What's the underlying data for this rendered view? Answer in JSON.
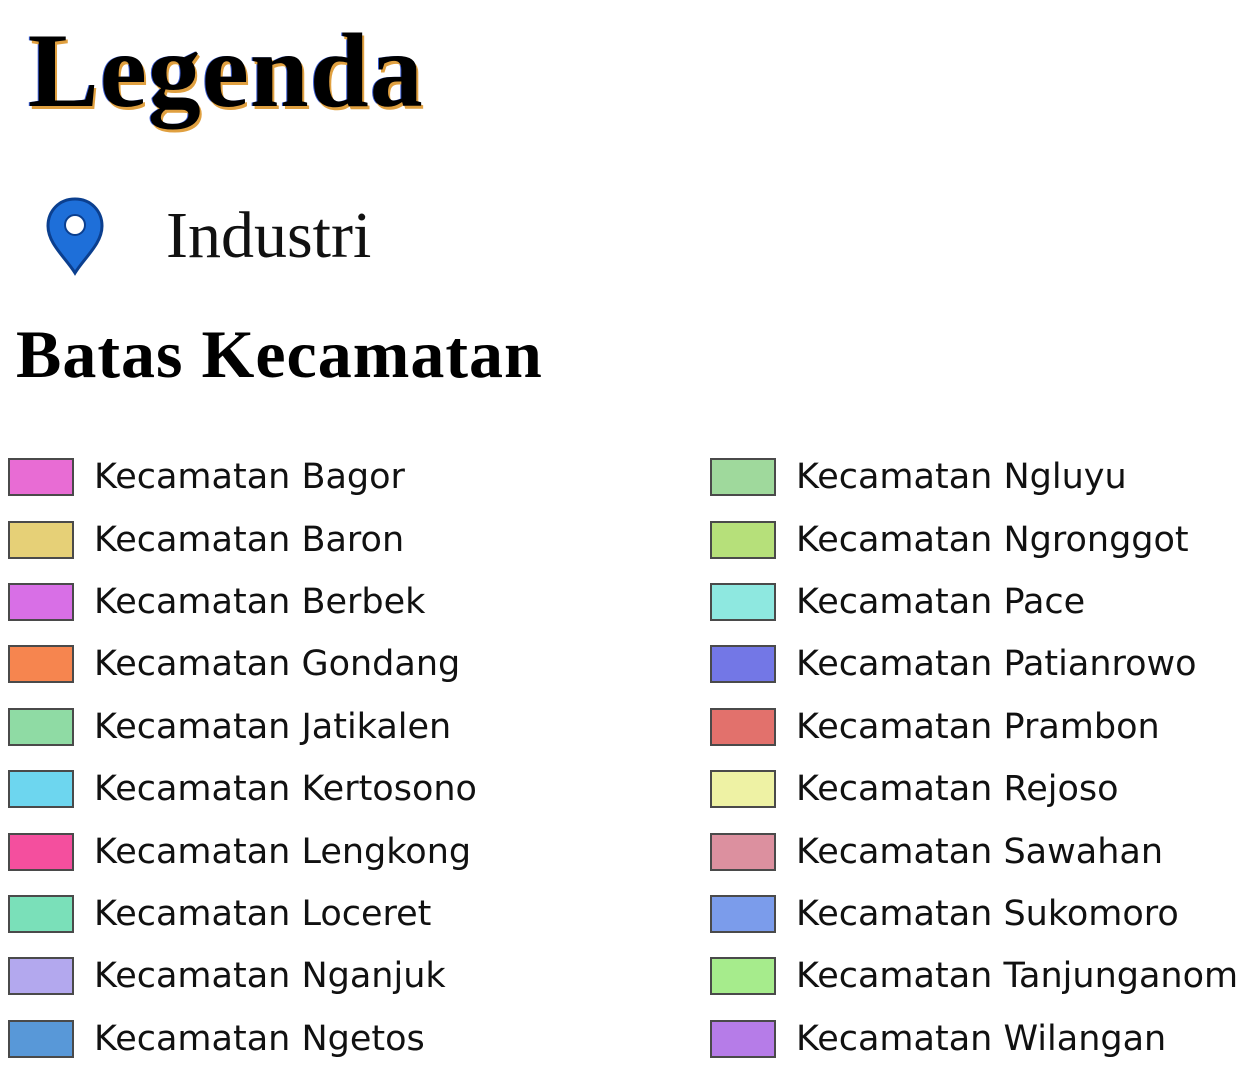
{
  "legend": {
    "title": "Legenda",
    "industri": {
      "icon": "map-pin-icon",
      "icon_color": "#1e6fd9",
      "label": "Industri"
    },
    "section_title": "Batas Kecamatan",
    "left_items": [
      {
        "label": "Kecamatan Bagor",
        "color": "#e86cd4"
      },
      {
        "label": "Kecamatan Baron",
        "color": "#e6d077"
      },
      {
        "label": "Kecamatan Berbek",
        "color": "#d86fe6"
      },
      {
        "label": "Kecamatan Gondang",
        "color": "#f6854f"
      },
      {
        "label": "Kecamatan Jatikalen",
        "color": "#8fdba4"
      },
      {
        "label": "Kecamatan Kertosono",
        "color": "#6dd6ef"
      },
      {
        "label": "Kecamatan Lengkong",
        "color": "#f44f9e"
      },
      {
        "label": "Kecamatan Loceret",
        "color": "#7ae0b9"
      },
      {
        "label": "Kecamatan Nganjuk",
        "color": "#b3a8ee"
      },
      {
        "label": "Kecamatan Ngetos",
        "color": "#5898d8"
      }
    ],
    "right_items": [
      {
        "label": "Kecamatan Ngluyu",
        "color": "#9fd99c"
      },
      {
        "label": "Kecamatan Ngronggot",
        "color": "#b6e07a"
      },
      {
        "label": "Kecamatan Pace",
        "color": "#8ee8e0"
      },
      {
        "label": "Kecamatan Patianrowo",
        "color": "#7377e6"
      },
      {
        "label": "Kecamatan Prambon",
        "color": "#e2716c"
      },
      {
        "label": "Kecamatan Rejoso",
        "color": "#eef2a4"
      },
      {
        "label": "Kecamatan Sawahan",
        "color": "#dc909f"
      },
      {
        "label": "Kecamatan Sukomoro",
        "color": "#7b9ceb"
      },
      {
        "label": "Kecamatan Tanjunganom",
        "color": "#a6ec8c"
      },
      {
        "label": "Kecamatan Wilangan",
        "color": "#b67ce8"
      }
    ]
  }
}
